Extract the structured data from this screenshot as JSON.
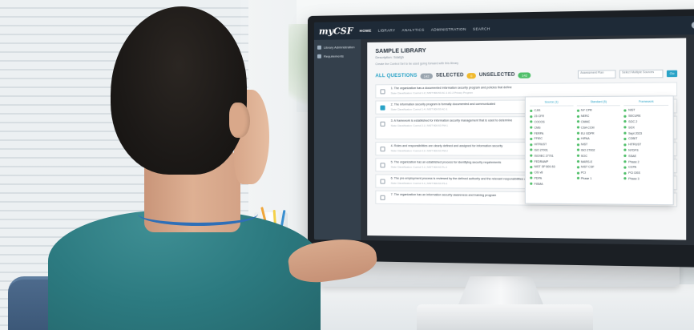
{
  "app": {
    "logo": "myCSF",
    "nav": [
      "HOME",
      "LIBRARY",
      "ANALYTICS",
      "ADMINISTRATION",
      "SEARCH"
    ],
    "sidebar": [
      "Library Administration",
      "Requirements"
    ]
  },
  "page": {
    "title": "SAMPLE LIBRARY",
    "subtitle": "Description: Sdafgh",
    "description": "Create the Control Set to be used going forward with this library"
  },
  "filters": {
    "all_label": "ALL QUESTIONS",
    "all_count": "142",
    "selected_label": "SELECTED",
    "selected_count": "0",
    "unselected_label": "UNSELECTED",
    "unselected_count": "142",
    "select_placeholder": "Assessment Plan",
    "search_placeholder": "Select Multiple Sources",
    "go_label": "Go"
  },
  "questions": [
    {
      "text": "1. The organization has a documented information security program and policies that define",
      "meta": "State Classification: Control 1.2 | NIST 800-53 AC-1 AC-2 Privacy Program"
    },
    {
      "text": "2. The information security program is formally documented and communicated",
      "meta": "State Classification: Control 1.4 | NIST 800-53 AC-1"
    },
    {
      "text": "3. A framework is established for information security management that is used to determine",
      "meta": "State Classification: Control 2.1 | NIST 800-53 PM-1"
    },
    {
      "text": "4. Roles and responsibilities are clearly defined and assigned for information security",
      "meta": "State Classification: Control 2.2 | NIST 800-53 PM-2"
    },
    {
      "text": "5. The organization has an established process for identifying security requirements",
      "meta": "State Classification: Control 3.1 | NIST 800-53 PL-2"
    },
    {
      "text": "6. The pre-employment process is reviewed by the defined authority and the relevant responsibilities are specifically defined in writing",
      "meta": "State Classification: Control 4.1 | NIST 800-53 PS-1"
    },
    {
      "text": "7. The organization has an information security awareness and training program",
      "meta": "State Classification: Control 5.1 | NIST 800-53 AT-1"
    }
  ],
  "dropdown": {
    "columns": [
      {
        "header": "Source (1)",
        "items": [
          "CJIS",
          "23 CFR",
          "COCOS",
          "CMS",
          "FERPA",
          "FFIEC",
          "HITRUST",
          "ISO 27001",
          "ISO/IEC 27701",
          "FEDRAMP",
          "NIST SP 800-53",
          "CIS v8",
          "PDPA",
          "FISMA"
        ]
      },
      {
        "header": "Standard (5)",
        "items": [
          "NY CPR",
          "NERC",
          "CMMC",
          "CSA CCM",
          "EU GDPR",
          "HIPAA",
          "NIST",
          "ISO 27002",
          "SOC",
          "MARS-E",
          "NIST CSF",
          "PCI",
          "Phase 1"
        ]
      },
      {
        "header": "Framework",
        "items": [
          "NIST",
          "SECURE",
          "SOC 2",
          "SOX",
          "Sept 2023",
          "COBIT",
          "HITRUST",
          "NYDFS",
          "SSAE",
          "Phase 2",
          "CCPA",
          "PCI DSS",
          "Phase 3"
        ]
      }
    ]
  },
  "colors": {
    "accent": "#2aa3c7",
    "nav_bg": "#1e2a37",
    "scrubs": "#2c7a80",
    "lanyard": "#2f6fb7"
  }
}
